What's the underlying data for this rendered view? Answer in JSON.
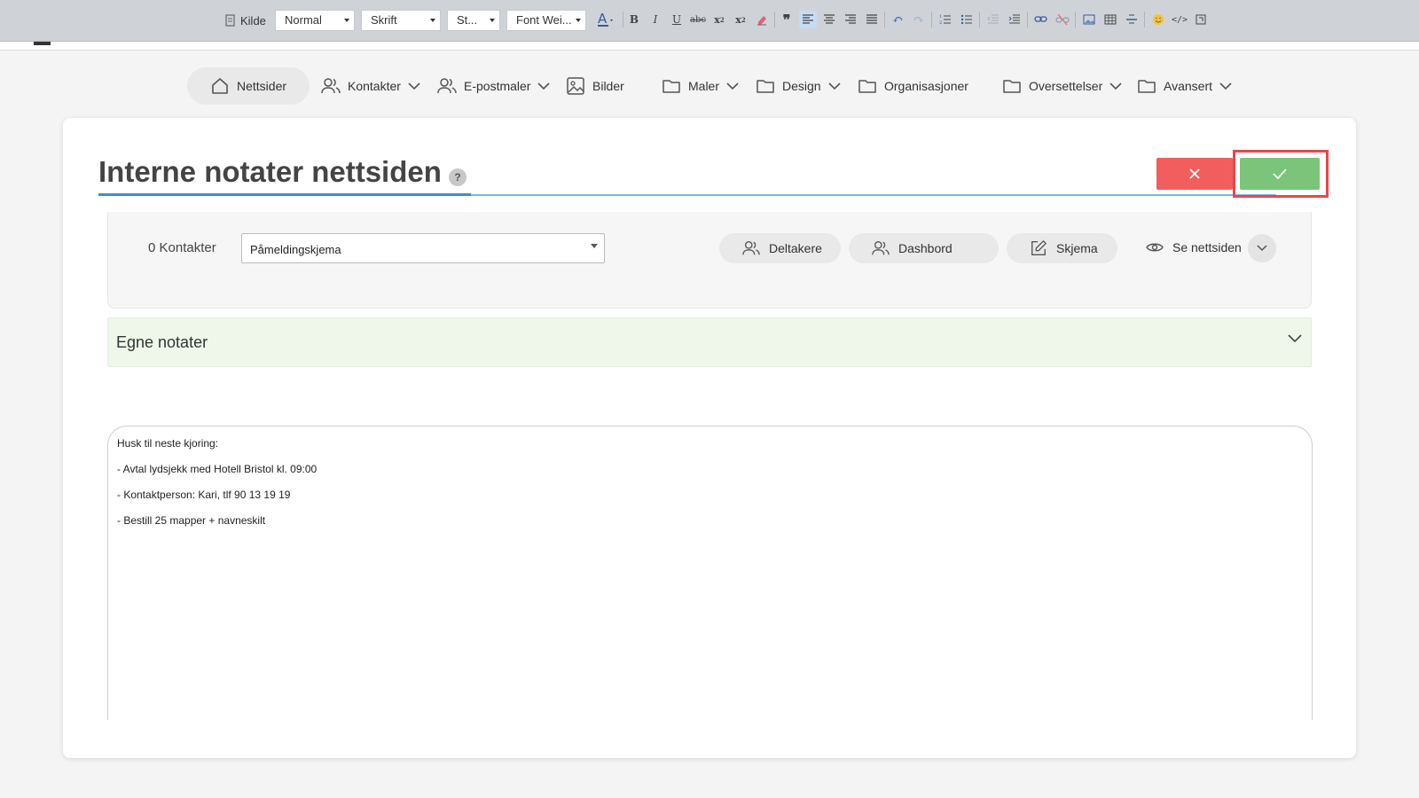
{
  "toolbar": {
    "source_label": "Kilde",
    "format_select": "Normal",
    "font_select": "Skrift",
    "size_select": "St...",
    "weight_select": "Font Wei..."
  },
  "nav": {
    "items": [
      {
        "label": "Nettsider"
      },
      {
        "label": "Kontakter"
      },
      {
        "label": "E-postmaler"
      },
      {
        "label": "Bilder"
      },
      {
        "label": "Maler"
      },
      {
        "label": "Design"
      },
      {
        "label": "Organisasjoner"
      },
      {
        "label": "Oversettelser"
      },
      {
        "label": "Avansert"
      }
    ]
  },
  "page": {
    "title": "Interne notater nettsiden",
    "help_symbol": "?"
  },
  "actions": {
    "cancel_symbol": "✕",
    "confirm_symbol": "✓"
  },
  "panel": {
    "contacts_count": "0 Kontakter",
    "form_selected": "Påmeldingskjema",
    "buttons": [
      {
        "label": "Deltakere"
      },
      {
        "label": "Dashbord"
      },
      {
        "label": "Skjema"
      }
    ],
    "view_link": "Se nettsiden"
  },
  "notes": {
    "section_title": "Egne notater",
    "lines": [
      "Husk til neste kjoring:",
      "- Avtal lydsjekk med Hotell Bristol kl. 09:00",
      "- Kontaktperson: Kari, tlf 90 13 19 19",
      "- Bestill 25 mapper + navneskilt"
    ]
  },
  "colors": {
    "cancel": "#f25e5e",
    "confirm": "#7bc47a",
    "highlight_frame": "#e8474c",
    "notes_header_bg": "#eef7ea",
    "accent_line": "#3a8fd1"
  }
}
